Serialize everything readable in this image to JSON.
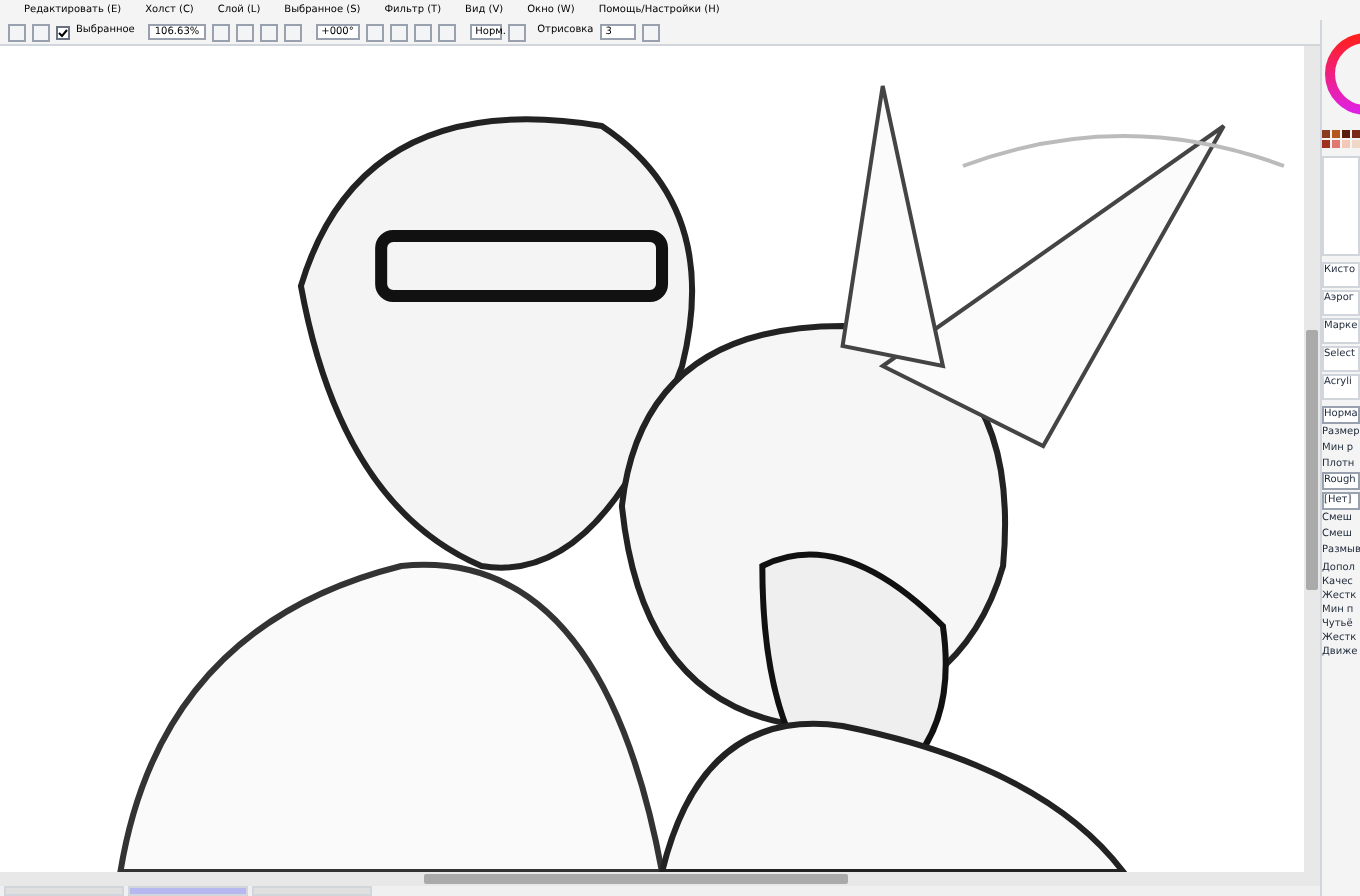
{
  "menu": [
    "Редактировать (E)",
    "Холст (C)",
    "Слой (L)",
    "Выбранное (S)",
    "Фильтр (T)",
    "Вид (V)",
    "Окно (W)",
    "Помощь/Настройки (H)"
  ],
  "toolbar": {
    "selection_checkbox": {
      "label": "Выбранное",
      "checked": true
    },
    "zoom": "106.63%",
    "angle": "+000°",
    "blend_mode": "Норм.",
    "stabilizer_label": "Отрисовка",
    "stabilizer_value": "3"
  },
  "swatches": [
    {
      "color": "#8a3a1e"
    },
    {
      "color": "#b5561e"
    },
    {
      "color": "#5a1e10"
    },
    {
      "color": "#7a2a18"
    },
    {
      "color": "#a03020"
    },
    {
      "color": "#e07a70"
    },
    {
      "color": "#f4c8b8"
    },
    {
      "color": "#f0d8c8"
    }
  ],
  "tools": [
    "Кисто",
    "Аэрог",
    "Марке",
    "Select",
    "Acryli"
  ],
  "brush": {
    "mode": "Норма",
    "settings": [
      "Размер",
      "Мин р",
      "Плотн"
    ],
    "texture": "Rough",
    "shape": "[Нет]",
    "blend_settings": [
      "Смеш",
      "Смеш",
      "Размыв"
    ],
    "advanced": "Допол",
    "advanced_settings": [
      "Качес",
      "Жестк",
      "Мин п",
      "Чутьё",
      "Жестк",
      "Движе"
    ]
  },
  "document_tabs": [
    {
      "selected": false
    },
    {
      "selected": true
    },
    {
      "selected": false
    }
  ]
}
